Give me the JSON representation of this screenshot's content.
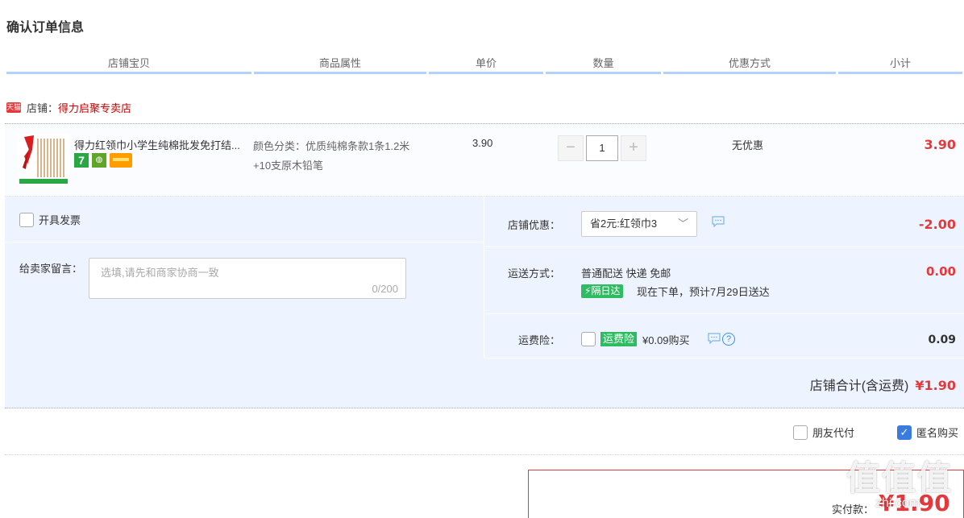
{
  "page_title": "确认订单信息",
  "columns": [
    "店铺宝贝",
    "商品属性",
    "单价",
    "数量",
    "优惠方式",
    "小计"
  ],
  "shop": {
    "badge": "天猫",
    "label": "店铺：",
    "name": "得力启聚专卖店"
  },
  "item": {
    "title": "得力红领巾小学生纯棉批发免打结...",
    "property": "颜色分类：优质纯棉条款1条1.2米+10支原木铅笔",
    "unit_price": "3.90",
    "quantity": "1",
    "minus": "−",
    "plus": "+",
    "discount": "无优惠",
    "subtotal": "3.90",
    "badge7": "7"
  },
  "invoice_label": "开具发票",
  "message": {
    "label": "给卖家留言：",
    "placeholder": "选填,请先和商家协商一致",
    "count": "0/200"
  },
  "shop_discount": {
    "label": "店铺优惠：",
    "selected": "省2元:红领巾3",
    "amount": "-2.00"
  },
  "shipping": {
    "label": "运送方式：",
    "method": "普通配送 快递 免邮",
    "tag": "隔日达",
    "delivery": "现在下单，预计7月29日送达",
    "amount": "0.00"
  },
  "insurance": {
    "label": "运费险：",
    "tag": "运费险",
    "price": "¥0.09购买",
    "help": "?",
    "amount": "0.09"
  },
  "shop_total": {
    "label": "店铺合计(含运费)",
    "amount": "¥1.90"
  },
  "friend_pay": "朋友代付",
  "anonymous": "匿名购买",
  "actual_pay": {
    "label": "实付款：",
    "amount": "¥1.90"
  },
  "watermark": {
    "text": "值值值",
    "url": "zhi.com"
  },
  "colors": {
    "accent_red": "#e4393c",
    "header_underline": "#b2d1ff",
    "panel_bg": "#eef4ff",
    "green_tag": "#2ebc62"
  }
}
